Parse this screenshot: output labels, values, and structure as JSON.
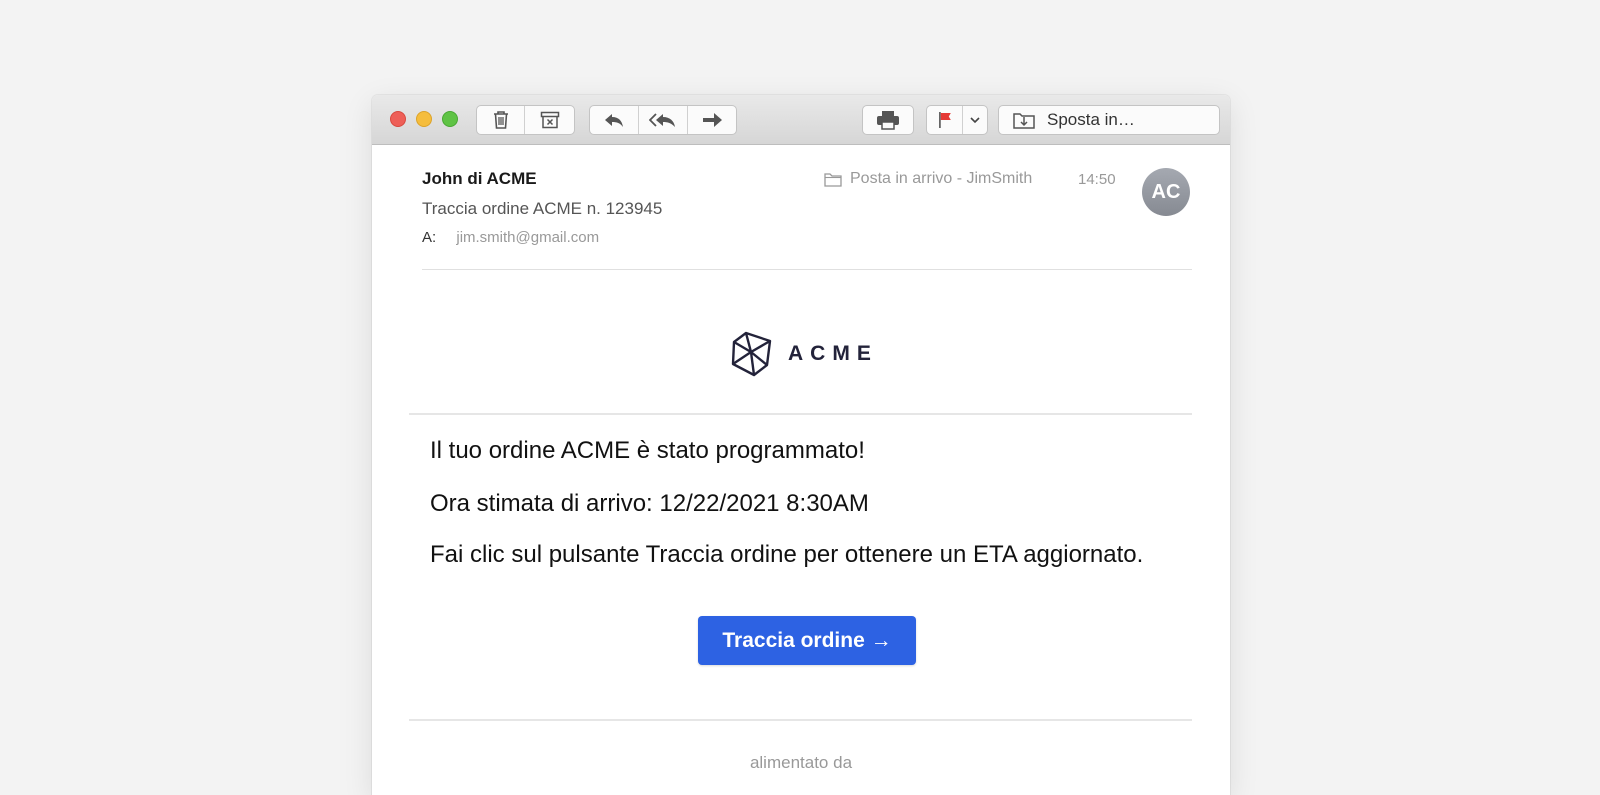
{
  "toolbar": {
    "move_label": "Sposta in…"
  },
  "email": {
    "sender": "John di ACME",
    "subject": "Traccia ordine ACME n. 123945",
    "to_label": "A:",
    "to_address": "jim.smith@gmail.com",
    "mailbox": "Posta in arrivo - JimSmith",
    "time": "14:50",
    "avatar_initials": "AC"
  },
  "body": {
    "brand": "ACME",
    "line1": "Il tuo ordine ACME è stato programmato!",
    "line2": "Ora stimata di arrivo: 12/22/2021 8:30AM",
    "line3": "Fai clic sul pulsante Traccia ordine per ottenere un ETA aggiornato.",
    "cta_label": "Traccia ordine →",
    "powered_by": "alimentato da"
  },
  "colors": {
    "accent": "#2d62e3",
    "flag": "#e53935",
    "close": "#ee5f58",
    "minimize": "#f5bd3d",
    "zoom": "#5fc345"
  },
  "icons": [
    "trash-icon",
    "archive-icon",
    "reply-icon",
    "reply-all-icon",
    "forward-icon",
    "printer-icon",
    "flag-icon",
    "chevron-down-icon",
    "move-to-folder-icon",
    "folder-icon",
    "acme-cube-logo"
  ]
}
